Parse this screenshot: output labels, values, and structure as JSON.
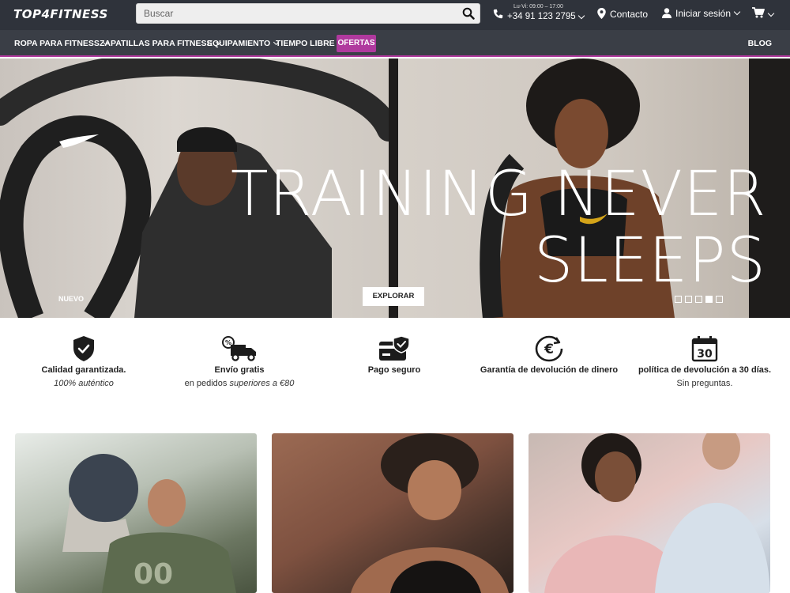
{
  "header": {
    "logo_text": "TOP4FITNESS",
    "search_placeholder": "Buscar",
    "hours": "Lu-Vi: 09:00 – 17:00",
    "phone": "+34 91 123 2795",
    "contact_label": "Contacto",
    "login_label": "Iniciar sesión"
  },
  "nav": {
    "items": [
      {
        "label": "ROPA PARA FITNESS"
      },
      {
        "label": "ZAPATILLAS PARA FITNESS"
      },
      {
        "label": "EQUIPAMIENTO"
      },
      {
        "label": "TIEMPO LIBRE"
      }
    ],
    "offer_label": "OFERTAS",
    "blog_label": "BLOG",
    "accent_color": "#b0399e"
  },
  "hero": {
    "headline_line1": "TRAINING NEVER",
    "headline_line2": "SLEEPS",
    "tag": "NUEVO",
    "cta_label": "EXPLORAR",
    "slide_count": 5,
    "active_slide": 4
  },
  "features": [
    {
      "icon": "shield-check-icon",
      "title": "Calidad garantizada.",
      "subtitle_plain": "",
      "subtitle_italic": "100% auténtico"
    },
    {
      "icon": "delivery-truck-icon",
      "title": "Envío gratis",
      "subtitle_plain": "en pedidos ",
      "subtitle_italic": "superiores a €80"
    },
    {
      "icon": "secure-card-icon",
      "title": "Pago seguro",
      "subtitle_plain": "",
      "subtitle_italic": ""
    },
    {
      "icon": "euro-return-icon",
      "title": "Garantía de devolución de dinero",
      "subtitle_plain": "",
      "subtitle_italic": ""
    },
    {
      "icon": "calendar-30-icon",
      "title": "política de devolución a 30 días.",
      "subtitle_plain": "Sin preguntas.",
      "subtitle_italic": ""
    }
  ],
  "calendar_number": "30"
}
